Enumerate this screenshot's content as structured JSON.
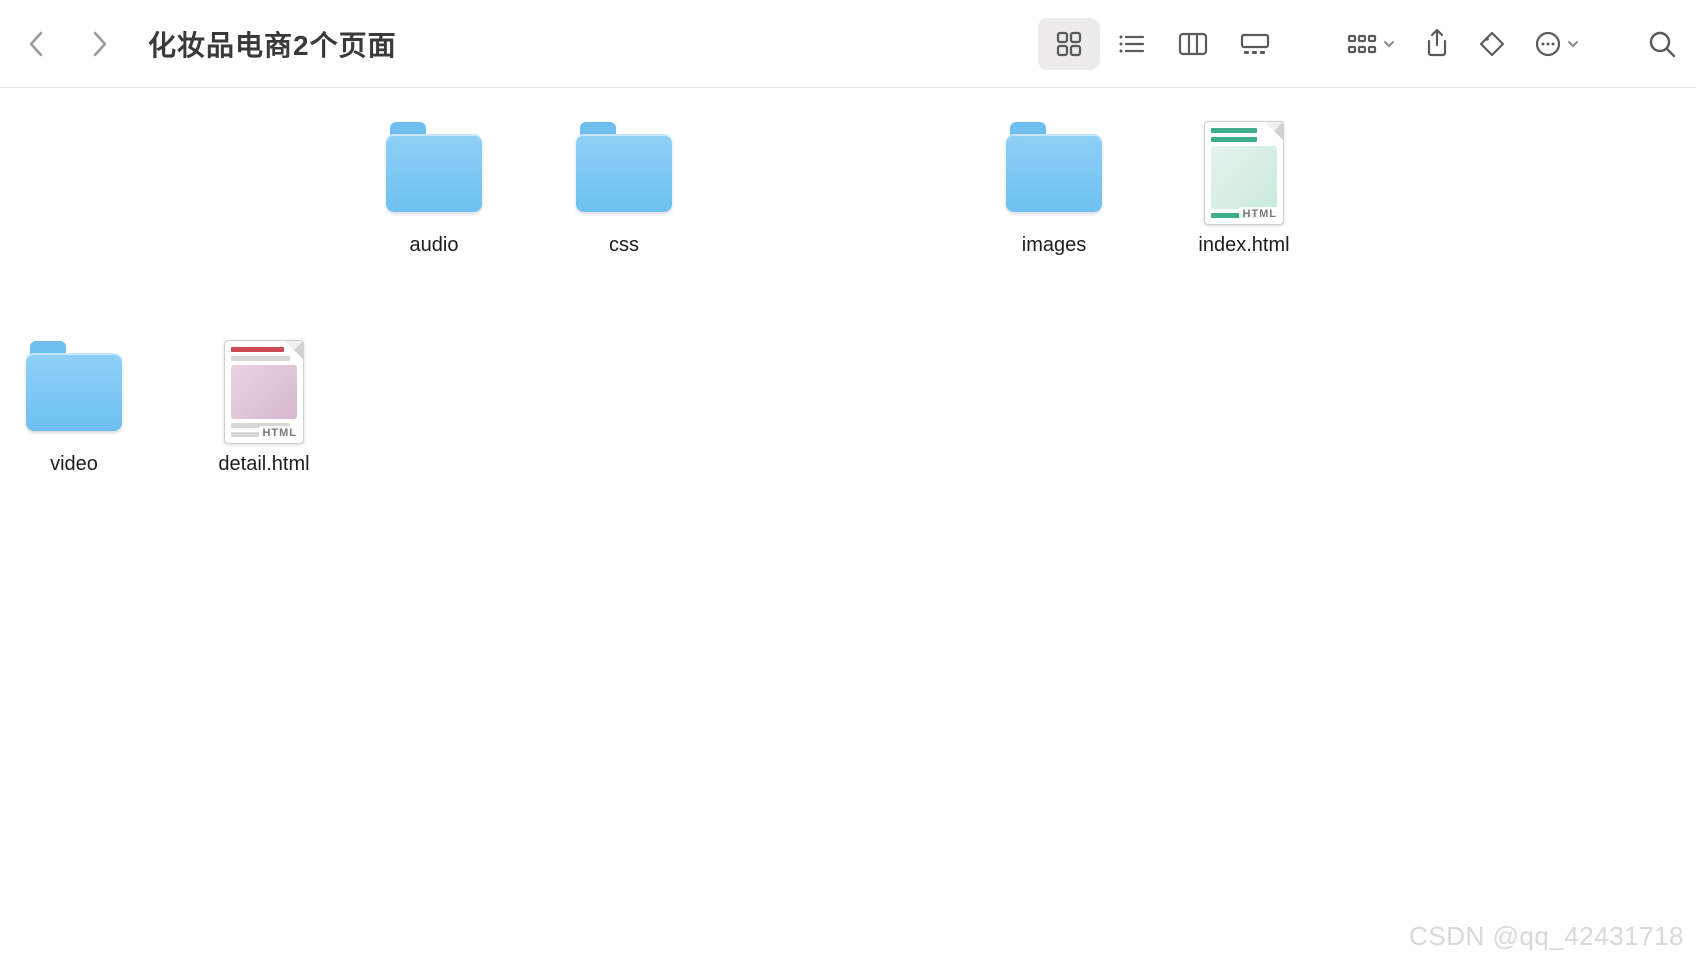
{
  "window": {
    "title": "化妆品电商2个页面"
  },
  "toolbar": {
    "view_modes": [
      "icon",
      "list",
      "column",
      "gallery"
    ],
    "active_view": "icon"
  },
  "items": [
    {
      "name": "audio",
      "type": "folder"
    },
    {
      "name": "css",
      "type": "folder"
    },
    {
      "name": "images",
      "type": "folder"
    },
    {
      "name": "index.html",
      "type": "html",
      "badge": "HTML",
      "variant": "index"
    },
    {
      "name": "video",
      "type": "folder"
    },
    {
      "name": "detail.html",
      "type": "html",
      "badge": "HTML",
      "variant": "detail"
    }
  ],
  "watermark": "CSDN @qq_42431718"
}
